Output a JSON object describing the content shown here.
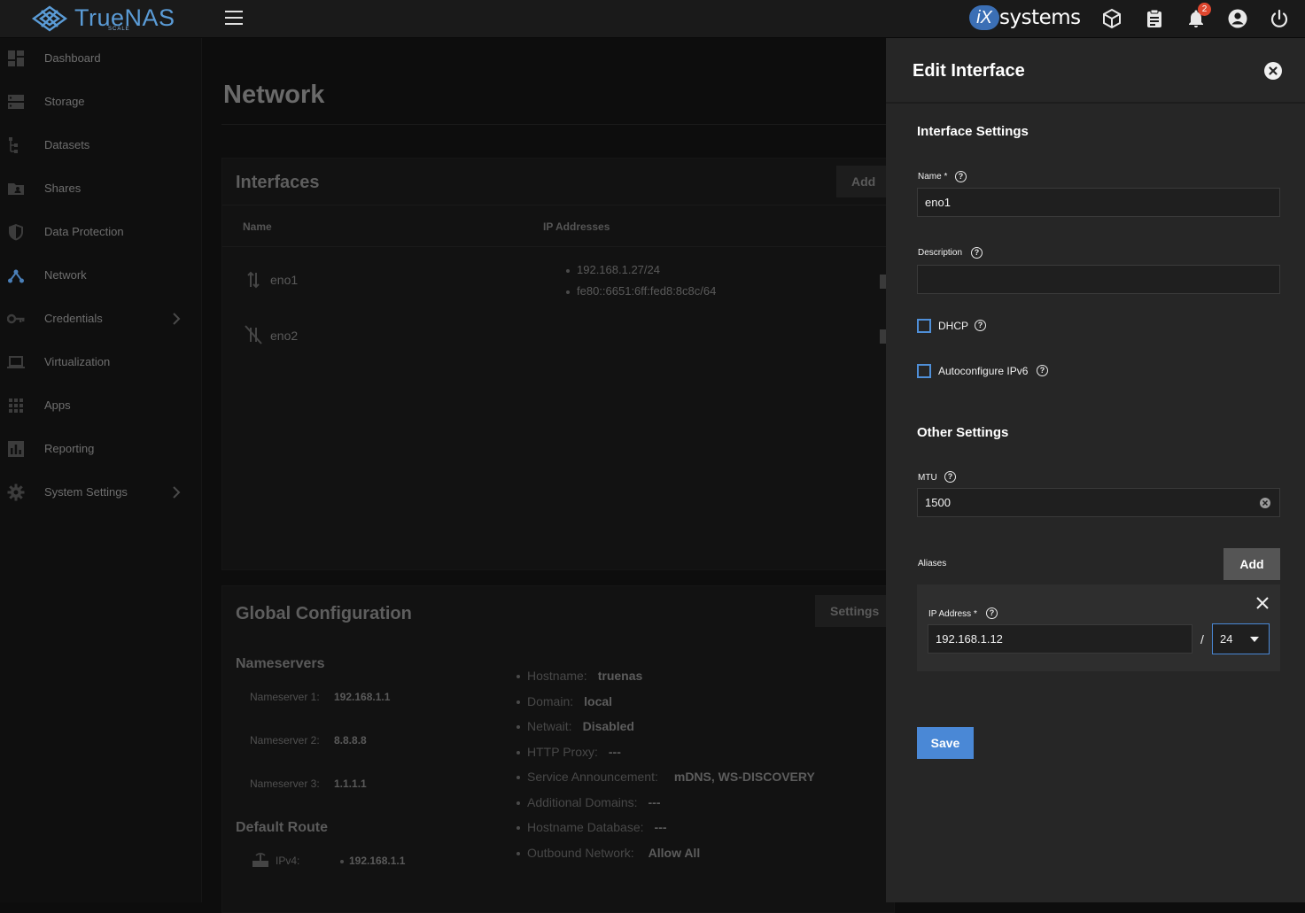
{
  "header": {
    "logo_text": "TrueNAS",
    "logo_sub": "SCALE",
    "vendor_logo_badge": "iX",
    "vendor_logo_text": "systems",
    "notification_count": "2"
  },
  "sidebar": {
    "items": [
      {
        "label": "Dashboard",
        "icon": "dashboard-icon"
      },
      {
        "label": "Storage",
        "icon": "storage-icon"
      },
      {
        "label": "Datasets",
        "icon": "datasets-icon"
      },
      {
        "label": "Shares",
        "icon": "shares-icon"
      },
      {
        "label": "Data Protection",
        "icon": "shield-icon"
      },
      {
        "label": "Network",
        "icon": "network-icon"
      },
      {
        "label": "Credentials",
        "icon": "key-icon"
      },
      {
        "label": "Virtualization",
        "icon": "laptop-icon"
      },
      {
        "label": "Apps",
        "icon": "apps-grid-icon"
      },
      {
        "label": "Reporting",
        "icon": "bar-chart-icon"
      },
      {
        "label": "System Settings",
        "icon": "gear-icon"
      }
    ]
  },
  "main": {
    "title": "Network",
    "interfaces": {
      "title": "Interfaces",
      "add_label": "Add",
      "col_name": "Name",
      "col_ip": "IP Addresses",
      "rows": [
        {
          "name": "eno1",
          "ips": [
            "192.168.1.27/24",
            "fe80::6651:6ff:fed8:8c8c/64"
          ]
        },
        {
          "name": "eno2",
          "ips": []
        }
      ]
    },
    "global": {
      "title": "Global Configuration",
      "settings_label": "Settings",
      "nameservers_title": "Nameservers",
      "nameservers": [
        {
          "label": "Nameserver 1:",
          "value": "192.168.1.1"
        },
        {
          "label": "Nameserver 2:",
          "value": "8.8.8.8"
        },
        {
          "label": "Nameserver 3:",
          "value": "1.1.1.1"
        }
      ],
      "default_route_title": "Default Route",
      "ipv4_label": "IPv4:",
      "ipv4_value": "192.168.1.1",
      "info": [
        {
          "label": "Hostname:",
          "value": "truenas"
        },
        {
          "label": "Domain:",
          "value": "local"
        },
        {
          "label": "Netwait:",
          "value": "Disabled"
        },
        {
          "label": "HTTP Proxy:",
          "value": "---"
        },
        {
          "label": "Service Announcement:",
          "value": "mDNS, WS-DISCOVERY"
        },
        {
          "label": "Additional Domains:",
          "value": "---"
        },
        {
          "label": "Hostname Database:",
          "value": "---"
        },
        {
          "label": "Outbound Network:",
          "value": "Allow All"
        }
      ]
    }
  },
  "panel": {
    "title": "Edit Interface",
    "interface_settings": "Interface Settings",
    "name_label": "Name",
    "name_value": "eno1",
    "description_label": "Description",
    "description_value": "",
    "dhcp_label": "DHCP",
    "autoconf_label": "Autoconfigure IPv6",
    "other_settings": "Other Settings",
    "mtu_label": "MTU",
    "mtu_value": "1500",
    "aliases_label": "Aliases",
    "add_label": "Add",
    "ip_label": "IP Address",
    "required_mark": "*",
    "ip_value": "192.168.1.12",
    "slash": "/",
    "netmask_value": "24",
    "save_label": "Save"
  }
}
